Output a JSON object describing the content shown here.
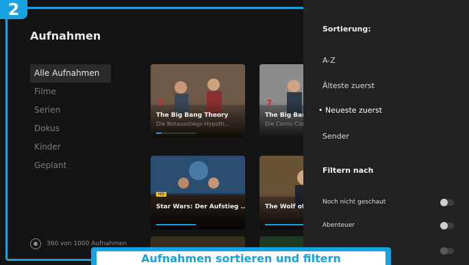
{
  "step_number": "2",
  "app": {
    "title": "Aufnahmen"
  },
  "nav": {
    "items": [
      {
        "label": "Alle Aufnahmen",
        "active": true
      },
      {
        "label": "Filme"
      },
      {
        "label": "Serien"
      },
      {
        "label": "Dokus"
      },
      {
        "label": "Kinder"
      },
      {
        "label": "Geplant"
      }
    ]
  },
  "storage": {
    "label": "360 von 1000 Aufnahmen",
    "icon": "disk-icon"
  },
  "tiles": [
    {
      "title": "The Big Bang Theory",
      "subtitle": "Die Notausstiegs-Hypoth...",
      "channel_logo": "7"
    },
    {
      "title": "The Big Bang T",
      "subtitle": "Die Comic-Con-",
      "channel_logo": "7"
    },
    {
      "title": "Star Wars: Der Aufstieg ...",
      "subtitle": "",
      "badge": "HD"
    },
    {
      "title": "The Wolf of Wa",
      "subtitle": ""
    }
  ],
  "panel": {
    "sort_heading": "Sortierung:",
    "sort_options": [
      {
        "label": "A-Z"
      },
      {
        "label": "Älteste zuerst"
      },
      {
        "label": "• Neueste zuerst",
        "selected": true
      },
      {
        "label": "Sender"
      }
    ],
    "filter_heading": "Filtern nach",
    "filters": [
      {
        "label": "Noch nicht geschaut",
        "on": false
      },
      {
        "label": "Abenteuer",
        "on": false
      }
    ]
  },
  "caption": {
    "text": "Aufnahmen sortieren und filtern"
  },
  "colors": {
    "accent": "#17a2e2",
    "panel_bg": "#222224",
    "background": "#141414"
  }
}
